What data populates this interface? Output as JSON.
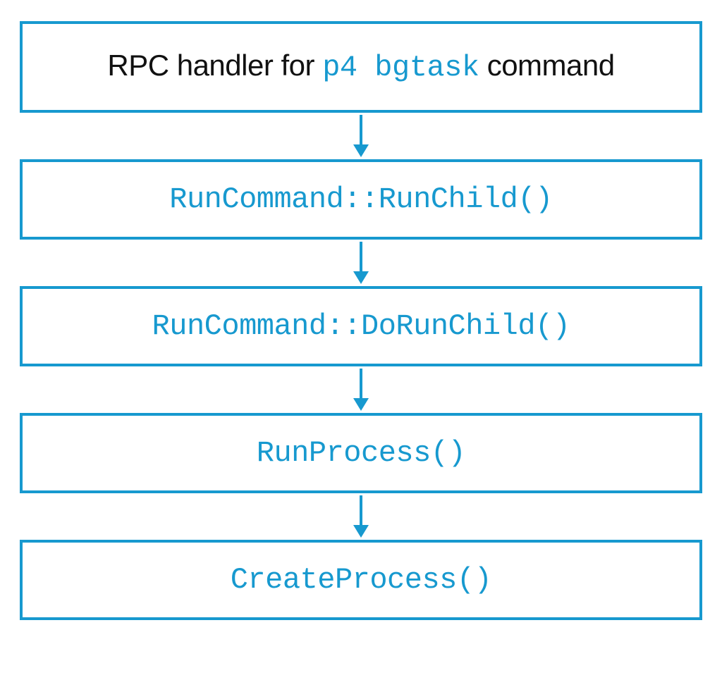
{
  "colors": {
    "accent": "#1799cf",
    "text": "#111111",
    "background": "#ffffff"
  },
  "diagram": {
    "nodes": [
      {
        "id": "rpc-handler",
        "parts": [
          {
            "text": "RPC handler for ",
            "style": "plain"
          },
          {
            "text": "p4 bgtask",
            "style": "code"
          },
          {
            "text": " command",
            "style": "plain"
          }
        ]
      },
      {
        "id": "run-child",
        "parts": [
          {
            "text": "RunCommand::RunChild()",
            "style": "code"
          }
        ]
      },
      {
        "id": "do-run-child",
        "parts": [
          {
            "text": "RunCommand::DoRunChild()",
            "style": "code"
          }
        ]
      },
      {
        "id": "run-process",
        "parts": [
          {
            "text": "RunProcess()",
            "style": "code"
          }
        ]
      },
      {
        "id": "create-process",
        "parts": [
          {
            "text": "CreateProcess()",
            "style": "code"
          }
        ]
      }
    ],
    "edges": [
      {
        "from": "rpc-handler",
        "to": "run-child"
      },
      {
        "from": "run-child",
        "to": "do-run-child"
      },
      {
        "from": "do-run-child",
        "to": "run-process"
      },
      {
        "from": "run-process",
        "to": "create-process"
      }
    ]
  }
}
